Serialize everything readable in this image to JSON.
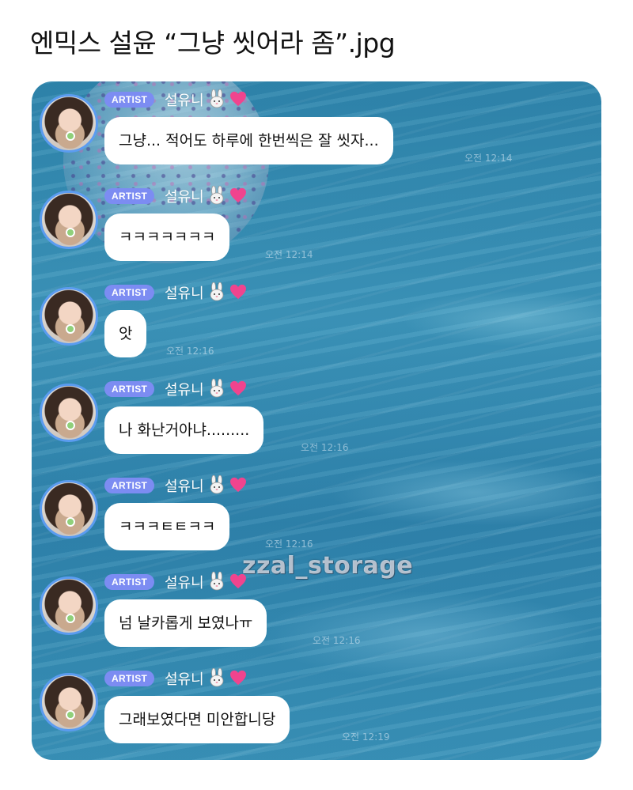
{
  "post": {
    "title": "엔믹스 설윤 “그냥 씻어라 좀”.jpg"
  },
  "chat": {
    "watermark": "zzal_storage",
    "messages": [
      {
        "badge": "ARTIST",
        "sender": "설유니",
        "text": "그냥... 적어도 하루에 한번씩은 잘 씻자...",
        "time": "오전 12:14"
      },
      {
        "badge": "ARTIST",
        "sender": "설유니",
        "text": "ㅋㅋㅋㅋㅋㅋㅋ",
        "time": "오전 12:14"
      },
      {
        "badge": "ARTIST",
        "sender": "설유니",
        "text": "앗",
        "time": "오전 12:16"
      },
      {
        "badge": "ARTIST",
        "sender": "설유니",
        "text": "나 화난거아냐.........",
        "time": "오전 12:16"
      },
      {
        "badge": "ARTIST",
        "sender": "설유니",
        "text": "ㅋㅋㅋㅌㅌㅋㅋ",
        "time": "오전 12:16"
      },
      {
        "badge": "ARTIST",
        "sender": "설유니",
        "text": "넘 날카롭게 보였나ㅠ",
        "time": "오전 12:16"
      },
      {
        "badge": "ARTIST",
        "sender": "설유니",
        "text": "그래보였다면 미안합니당",
        "time": "오전 12:19"
      }
    ]
  },
  "icons": {
    "bunny": "bunny-emoji-icon",
    "heart": "pink-heart-icon"
  },
  "colors": {
    "badge": "#7c8cf2",
    "avatar_ring": "#5b9cf0",
    "heart": "#f0448e",
    "bubble": "#ffffff"
  }
}
